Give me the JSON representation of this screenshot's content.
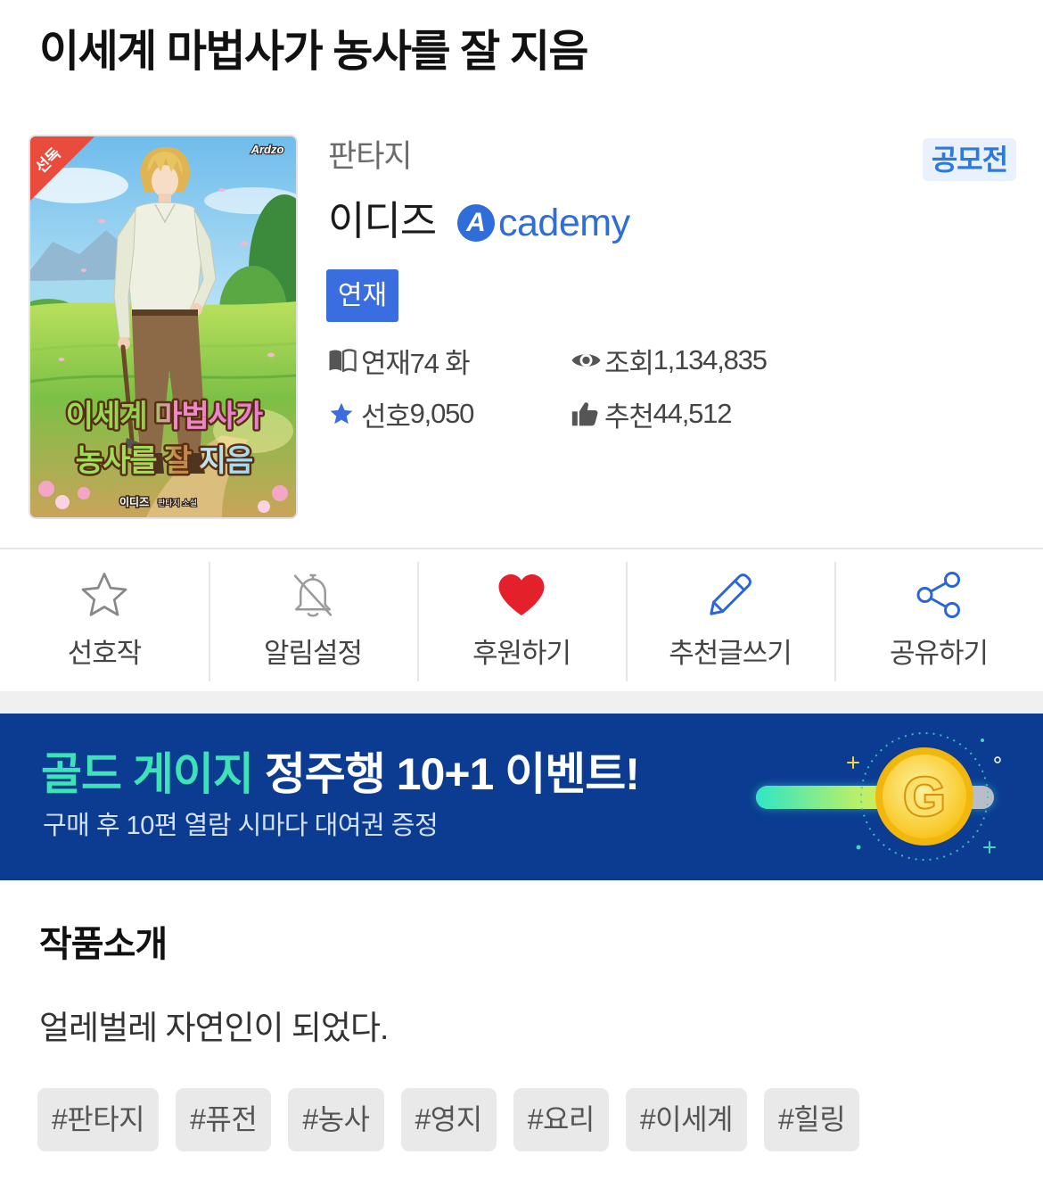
{
  "page": {
    "title": "이세계 마법사가 농사를 잘 지음"
  },
  "cover": {
    "ribbon": "선독",
    "logo": "Ardzo",
    "title_line1": "이세계 마법사가",
    "title_line2": "농사를 잘 지음",
    "byline_author": "이디즈",
    "byline_genre": "판타지 소설"
  },
  "info": {
    "genre": "판타지",
    "contest_badge": "공모전",
    "author": "이디즈",
    "academy_logo": {
      "mark": "A",
      "text": "cademy"
    },
    "status_badge": "연재",
    "stats": [
      {
        "icon": "book-icon",
        "label": "연재",
        "value": "74 화"
      },
      {
        "icon": "eye-icon",
        "label": "조회",
        "value": "1,134,835"
      },
      {
        "icon": "star-icon",
        "label": "선호",
        "value": "9,050"
      },
      {
        "icon": "thumbs-up-icon",
        "label": "추천",
        "value": "44,512"
      }
    ]
  },
  "actions": [
    {
      "icon": "star-outline-icon",
      "label": "선호작"
    },
    {
      "icon": "bell-off-icon",
      "label": "알림설정"
    },
    {
      "icon": "heart-icon",
      "label": "후원하기"
    },
    {
      "icon": "pencil-icon",
      "label": "추천글쓰기"
    },
    {
      "icon": "share-icon",
      "label": "공유하기"
    }
  ],
  "banner": {
    "highlight": "골드 게이지",
    "headline": "정주행 10+1 이벤트!",
    "subtitle": "구매 후 10편 열람 시마다 대여권 증정",
    "coin_letter": "G",
    "gauge_level": 0.7
  },
  "intro": {
    "heading": "작품소개",
    "description": "얼레벌레 자연인이 되었다."
  },
  "tags": [
    "#판타지",
    "#퓨전",
    "#농사",
    "#영지",
    "#요리",
    "#이세계",
    "#힐링"
  ],
  "colors": {
    "accent_blue": "#3a6de0",
    "academy_blue": "#2f6ed8",
    "contest_badge_text": "#2d7ad8",
    "contest_badge_bg": "#e8f1fc",
    "heart_red": "#e4202a",
    "action_blue": "#2b66d6",
    "banner_bg": "#0b3c92",
    "highlight_mint": "#3de2b6",
    "tag_bg": "#e9e9e9"
  }
}
